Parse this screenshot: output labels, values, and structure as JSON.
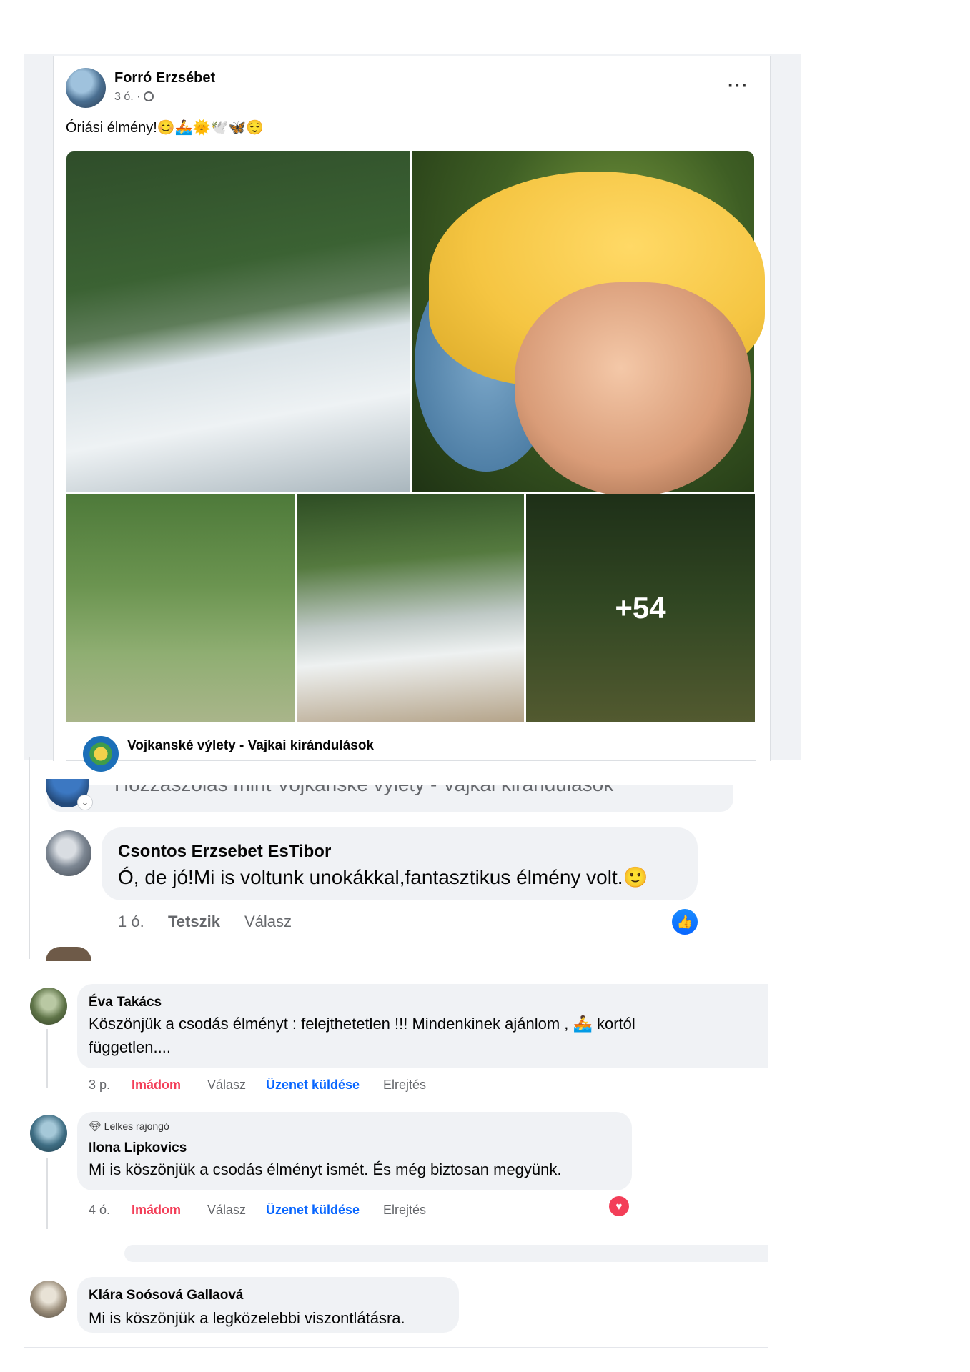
{
  "post": {
    "author": "Forró Erzsébet",
    "meta": "3 ó. · ",
    "globe_icon": "globe-icon",
    "more_label": "···",
    "text": "Óriási élmény!",
    "emojis": "😊🚣🌞🕊️🦋😌",
    "more_photos": "+54",
    "group_name": "Vojkanské výlety - Vajkai kirándulások"
  },
  "partial_comment_box": {
    "placeholder": "Hozzászólás mint Vojkanské výlety - Vajkai kirándulások"
  },
  "comment_main": {
    "name": "Csontos Erzsebet EsTibor",
    "text": "Ó, de jó!Mi is voltunk unokákkal,fantasztikus élmény volt.🙂",
    "time": "1 ó.",
    "like_label": "Tetszik",
    "reply_label": "Válasz",
    "reaction_icon": "like-icon"
  },
  "comments": [
    {
      "name": "Éva Takács",
      "text_line1": "Köszönjük a csodás élményt : felejthetetlen !!! Mindenkinek ajánlom , 🚣 kortól",
      "text_line2": "független....",
      "time": "3 p.",
      "love_label": "Imádom",
      "reply_label": "Válasz",
      "message_label": "Üzenet küldése",
      "hide_label": "Elrejtés"
    },
    {
      "badge": "Lelkes rajongó",
      "name": "Ilona Lipkovics",
      "text_line1": "Mi is köszönjük a csodás élményt ismét. És még biztosan megyünk.",
      "time": "4 ó.",
      "love_label": "Imádom",
      "reply_label": "Válasz",
      "message_label": "Üzenet küldése",
      "hide_label": "Elrejtés",
      "reaction_icon": "heart-icon"
    },
    {
      "name": "Klára Soósová Gallaová",
      "text_line1": "Mi is köszönjük a legközelebbi viszontlátásra."
    }
  ],
  "colors": {
    "love": "#f33e58",
    "link": "#0866ff",
    "bubble": "#f0f2f5",
    "meta": "#65676b"
  }
}
